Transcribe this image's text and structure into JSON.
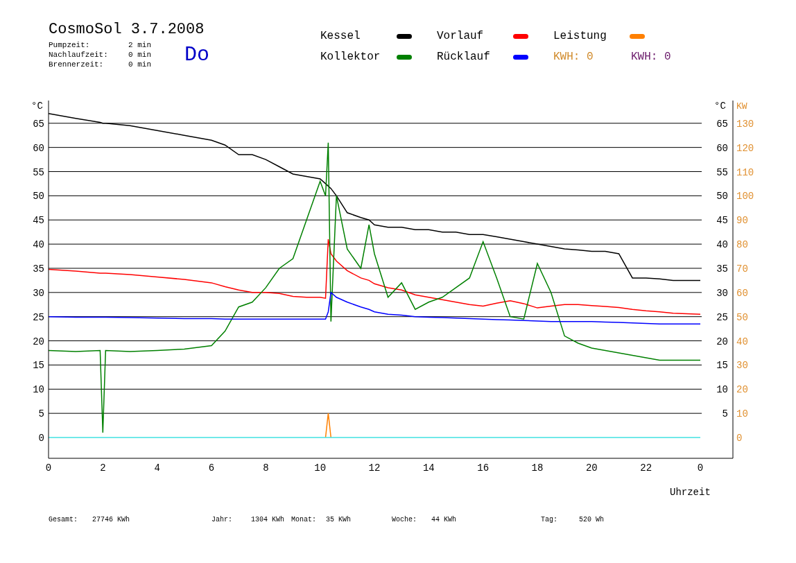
{
  "header": {
    "title": "CosmoSol 3.7.2008",
    "times": [
      {
        "label": "Pumpzeit:",
        "value": "2 min"
      },
      {
        "label": "Nachlaufzeit:",
        "value": "0 min"
      },
      {
        "label": "Brennerzeit:",
        "value": "0 min"
      }
    ],
    "weekday": "Do"
  },
  "chart": {
    "chart_data": {
      "type": "line",
      "xlabel": "Uhrzeit",
      "ylabel": "°C",
      "x": [
        0,
        1,
        1.9,
        2,
        2.1,
        3,
        4,
        5,
        6,
        6.5,
        7,
        7.5,
        8,
        8.5,
        9,
        9.5,
        10,
        10.2,
        10.3,
        10.4,
        10.6,
        11,
        11.5,
        11.8,
        12,
        12.5,
        13,
        13.5,
        14,
        14.5,
        15,
        15.5,
        16,
        16.5,
        17,
        17.5,
        18,
        18.5,
        19,
        19.5,
        20,
        20.5,
        21,
        21.5,
        22,
        22.5,
        23,
        23.5,
        24
      ],
      "xlim": [
        0,
        25.2
      ],
      "ylim": [
        -4.3,
        69.7
      ],
      "y2lim": [
        -8.6,
        139.4
      ],
      "y2label": "KW",
      "y2ticks": [
        0,
        10,
        20,
        30,
        40,
        50,
        60,
        70,
        80,
        90,
        100,
        110,
        120,
        130
      ],
      "xticks": [
        0,
        2,
        4,
        6,
        8,
        10,
        12,
        14,
        16,
        18,
        20,
        22
      ],
      "yticks": [
        0,
        5,
        10,
        15,
        20,
        25,
        30,
        35,
        40,
        45,
        50,
        55,
        60,
        65
      ],
      "series": [
        {
          "name": "Kessel",
          "color": "#000000",
          "values": [
            67,
            66,
            65.2,
            65,
            65,
            64.5,
            63.5,
            62.5,
            61.5,
            60.5,
            58.5,
            58.5,
            57.5,
            56,
            54.5,
            54,
            53.5,
            52.5,
            52,
            51.5,
            50,
            46.5,
            45.5,
            45,
            44,
            43.5,
            43.5,
            43,
            43,
            42.5,
            42.5,
            42,
            42,
            41.5,
            41,
            40.5,
            40,
            39.5,
            39,
            38.8,
            38.5,
            38.5,
            38,
            33,
            33,
            32.8,
            32.5,
            32.5,
            32.5
          ]
        },
        {
          "name": "Vorlauf",
          "color": "#ff0000",
          "values": [
            34.8,
            34.4,
            34,
            34,
            34,
            33.7,
            33.2,
            32.7,
            32,
            31.2,
            30.5,
            30,
            30,
            29.8,
            29.2,
            29,
            29,
            28.8,
            41,
            38,
            36.5,
            34.5,
            33,
            32.5,
            31.8,
            31,
            30.5,
            29.5,
            29,
            28.5,
            28,
            27.5,
            27.2,
            27.8,
            28.3,
            27.7,
            26.8,
            27.2,
            27.5,
            27.5,
            27.3,
            27.1,
            26.9,
            26.5,
            26.2,
            26,
            25.7,
            25.6,
            25.5
          ]
        },
        {
          "name": "Leistung",
          "color": "#ff8000",
          "axis": "y2",
          "values": [
            null,
            null,
            null,
            null,
            null,
            null,
            null,
            null,
            null,
            null,
            null,
            null,
            null,
            null,
            null,
            null,
            null,
            0,
            10,
            0,
            null,
            null,
            null,
            null,
            null,
            null,
            null,
            null,
            null,
            null,
            null,
            null,
            null,
            null,
            null,
            null,
            null,
            null,
            null,
            null,
            null,
            null,
            null,
            null,
            null,
            null,
            null,
            null,
            null
          ]
        },
        {
          "name": "Kollektor",
          "color": "#008000",
          "values": [
            18,
            17.8,
            18,
            1,
            18,
            17.8,
            18,
            18.3,
            19,
            22,
            27,
            28,
            31,
            35,
            37,
            45,
            53,
            50,
            61,
            24,
            50,
            39,
            35,
            44,
            38,
            29,
            32,
            26.5,
            28,
            29,
            31,
            33,
            40.5,
            33,
            25,
            24.5,
            36,
            30,
            21,
            19.5,
            18.5,
            18,
            17.5,
            17,
            16.5,
            16,
            16,
            16,
            16
          ]
        },
        {
          "name": "Rücklauf",
          "color": "#0000ff",
          "values": [
            25,
            24.9,
            24.9,
            24.9,
            24.9,
            24.8,
            24.7,
            24.6,
            24.6,
            24.5,
            24.5,
            24.5,
            24.5,
            24.5,
            24.5,
            24.5,
            24.5,
            24.5,
            26,
            30,
            29,
            28,
            27,
            26.5,
            26,
            25.5,
            25.3,
            25,
            24.9,
            24.8,
            24.7,
            24.6,
            24.5,
            24.4,
            24.3,
            24.2,
            24.1,
            24,
            24,
            24,
            24,
            23.9,
            23.8,
            23.7,
            23.6,
            23.5,
            23.5,
            23.5,
            23.5
          ]
        },
        {
          "color": "#40e0e0",
          "values": [
            0,
            0,
            0,
            0,
            0,
            0,
            0,
            0,
            0,
            0,
            0,
            0,
            0,
            0,
            0,
            0,
            0,
            0,
            0,
            0,
            0,
            0,
            0,
            0,
            0,
            0,
            0,
            0,
            0,
            0,
            0,
            0,
            0,
            0,
            0,
            0,
            0,
            0,
            0,
            0,
            0,
            0,
            0,
            0,
            0,
            0,
            0,
            0,
            0
          ]
        }
      ]
    },
    "midnight_tick": "0",
    "right_axis": {
      "label": "°C",
      "ticks": [
        "65",
        "60",
        "55",
        "50",
        "45",
        "40",
        "35",
        "30",
        "25",
        "20",
        "15",
        "10",
        "5"
      ]
    },
    "kw_axis": {
      "color": "#e09030"
    }
  },
  "legend": {
    "readings": [
      {
        "label": "KWH: 0",
        "color": "#d08a2a"
      },
      {
        "label": "KWH: 0",
        "color": "#6a1a6a"
      }
    ]
  },
  "totals": [
    {
      "label": "Gesamt:",
      "value": "27746 KWh"
    },
    {
      "label": "Jahr:",
      "value": "1304 KWh"
    },
    {
      "label": "Monat:",
      "value": "35 KWh"
    },
    {
      "label": "Woche:",
      "value": "44 KWh"
    },
    {
      "label": "Tag:",
      "value": "520 Wh"
    }
  ]
}
